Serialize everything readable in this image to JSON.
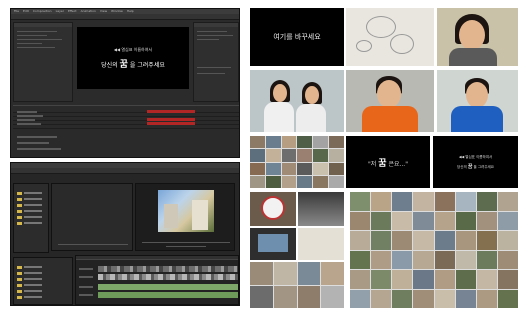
{
  "ae_window": {
    "menu": [
      "File",
      "Edit",
      "Composition",
      "Layer",
      "Effect",
      "Animation",
      "View",
      "Window",
      "Help"
    ],
    "comp_line1": "◀◀ 열심표 이름하여서",
    "comp_line2_pre": "당신의",
    "comp_line2_big": "꿈",
    "comp_line2_post": "을 그려주세요"
  },
  "collage": {
    "card_top_text": "여기를 바꾸세요",
    "card_quote_pre": "\"저",
    "card_quote_big": "꿈",
    "card_quote_post": "은요...\"",
    "card_small_line1": "◀◀ 열심표 이름하여서",
    "card_small_line2_pre": "당신의",
    "card_small_line2_big": "꿈",
    "card_small_line2_post": "을 그려주세요"
  },
  "colors": {
    "ae_background": "#2b2b2b",
    "timeline_red": "#b32626",
    "orange_shirt": "#e8661a",
    "blue_shirt": "#1f5fc0"
  }
}
